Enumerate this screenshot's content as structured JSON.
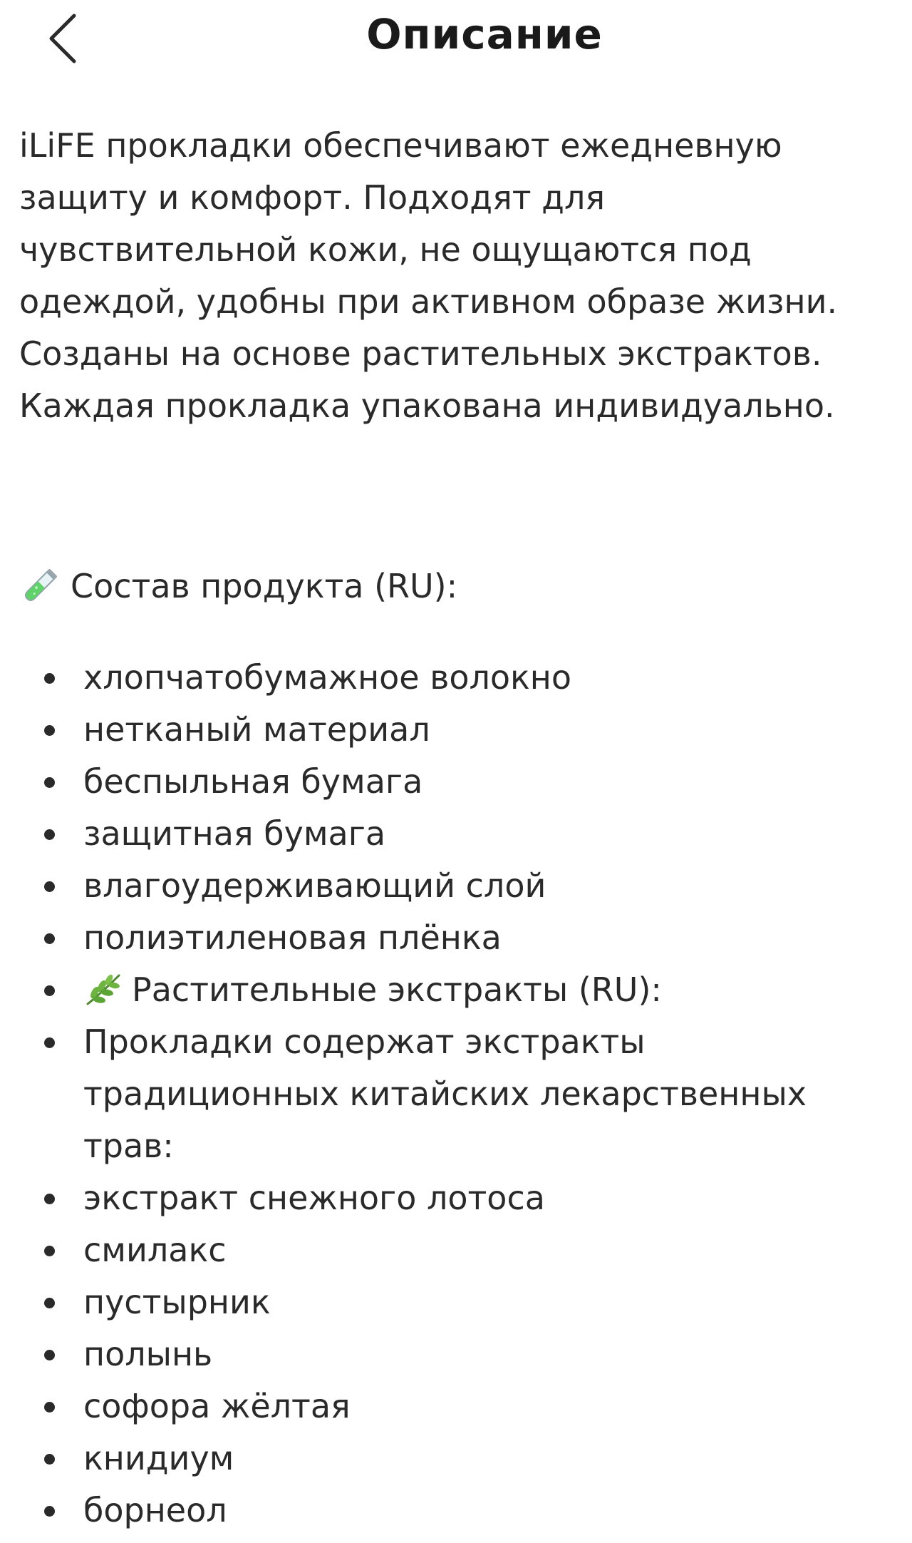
{
  "header": {
    "title": "Описание",
    "back_icon": "chevron-left-icon"
  },
  "description": {
    "text": "iLiFE прокладки обеспечивают ежедневную защиту и комфорт. Подходят для чувствительной кожи, не ощущаются под одеждой, удобны при активном образе жизни. Созданы на основе растительных экстрактов. Каждая прокладка упакована индивидуально."
  },
  "composition": {
    "icon": "test-tube-icon",
    "heading": "Состав продукта (RU):",
    "items": [
      "хлопчатобумажное волокно",
      "нетканый материал",
      "беспыльная бумага",
      "защитная бумага",
      "влагоудерживающий слой",
      "полиэтиленовая плёнка",
      "Растительные экстракты (RU):",
      "Прокладки содержат экстракты традиционных китайских лекарственных трав:",
      "экстракт снежного лотоса",
      "смилакс",
      "пустырник",
      "полынь",
      "софора жёлтая",
      "книдиум",
      "борнеол"
    ],
    "herb_icon": "herb-icon"
  },
  "colors": {
    "text": "#2a2a2a",
    "title": "#1a1a1a",
    "background": "#ffffff"
  }
}
